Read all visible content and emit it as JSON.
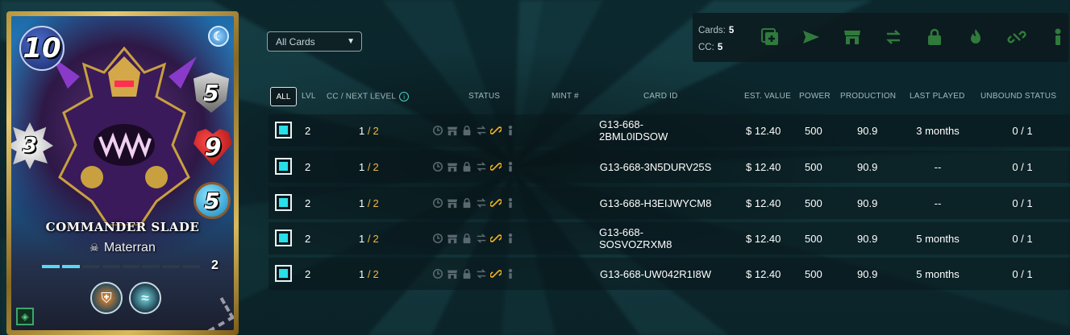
{
  "card": {
    "mana": "10",
    "armor": "5",
    "health": "9",
    "speed": "3",
    "magic": "5",
    "name": "COMMANDER SLADE",
    "edition": "Materran",
    "level": "2",
    "level_progress": 0.25,
    "element_icon": "water-swirl-icon",
    "abilities": [
      "shield-ability-icon",
      "wave-ability-icon"
    ]
  },
  "filter": {
    "selected": "All Cards"
  },
  "summary": {
    "cards_label": "Cards:",
    "cards_value": "5",
    "cc_label": "CC:",
    "cc_value": "5",
    "action_icons": [
      "combine-icon",
      "send-icon",
      "market-icon",
      "transfer-icon",
      "lock-icon",
      "burn-icon",
      "unbind-icon",
      "delegate-icon"
    ],
    "action_color": "#2f7a3c"
  },
  "table": {
    "select_all_label": "ALL",
    "columns": {
      "lvl": "LVL",
      "cc": "CC / NEXT LEVEL",
      "status": "STATUS",
      "mint": "MINT #",
      "card_id": "CARD ID",
      "est_value": "EST. VALUE",
      "power": "POWER",
      "production": "PRODUCTION",
      "last_played": "LAST PLAYED",
      "unbound": "UNBOUND STATUS"
    },
    "rows": [
      {
        "lvl": "2",
        "cc": "1",
        "next": "2",
        "mint": "",
        "card_id": "G13-668-2BML0IDSOW",
        "est_value": "$ 12.40",
        "power": "500",
        "production": "90.9",
        "last_played": "3 months",
        "unbound": "0 / 1"
      },
      {
        "lvl": "2",
        "cc": "1",
        "next": "2",
        "mint": "",
        "card_id": "G13-668-3N5DURV25S",
        "est_value": "$ 12.40",
        "power": "500",
        "production": "90.9",
        "last_played": "--",
        "unbound": "0 / 1"
      },
      {
        "lvl": "2",
        "cc": "1",
        "next": "2",
        "mint": "",
        "card_id": "G13-668-H3EIJWYCM8",
        "est_value": "$ 12.40",
        "power": "500",
        "production": "90.9",
        "last_played": "--",
        "unbound": "0 / 1"
      },
      {
        "lvl": "2",
        "cc": "1",
        "next": "2",
        "mint": "",
        "card_id": "G13-668-SOSVOZRXM8",
        "est_value": "$ 12.40",
        "power": "500",
        "production": "90.9",
        "last_played": "5 months",
        "unbound": "0 / 1"
      },
      {
        "lvl": "2",
        "cc": "1",
        "next": "2",
        "mint": "",
        "card_id": "G13-668-UW042R1I8W",
        "est_value": "$ 12.40",
        "power": "500",
        "production": "90.9",
        "last_played": "5 months",
        "unbound": "0 / 1"
      }
    ]
  },
  "colors": {
    "accent_cyan": "#28e0e8",
    "cc_next_gold": "#f0b840",
    "link_icon": "#f0b020"
  }
}
